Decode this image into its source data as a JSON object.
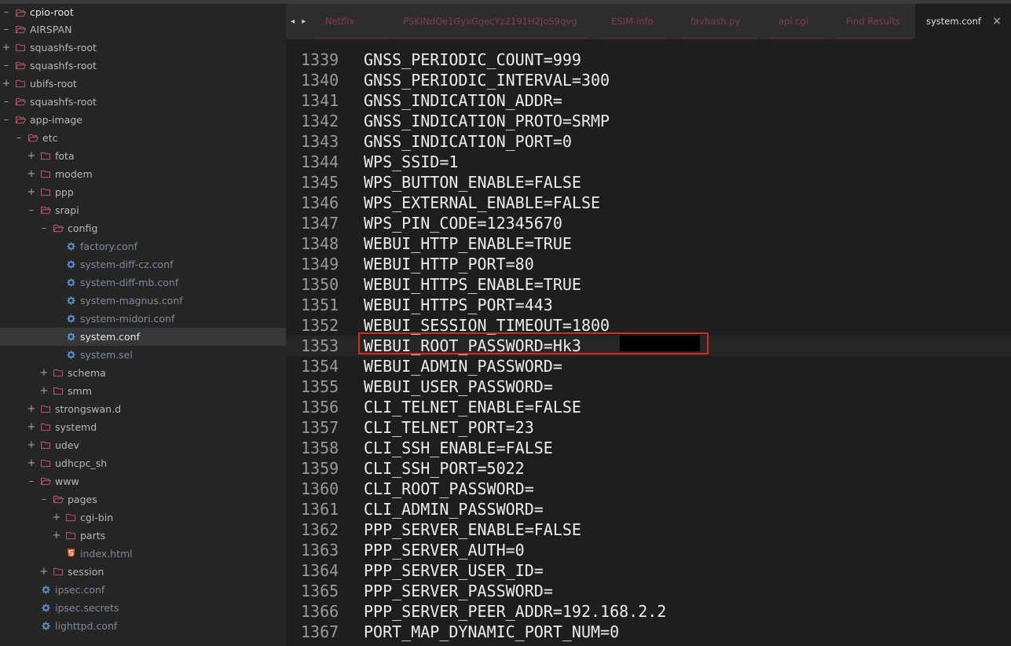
{
  "sidebar": {
    "tree": [
      {
        "label": "cpio-root",
        "depth": 0,
        "kind": "folder",
        "expanded": true
      },
      {
        "label": "AIRSPAN",
        "depth": 0,
        "kind": "folder",
        "expanded": true
      },
      {
        "label": "squashfs-root",
        "depth": 0,
        "kind": "folder",
        "expanded": false
      },
      {
        "label": "squashfs-root",
        "depth": 0,
        "kind": "folder",
        "expanded": true
      },
      {
        "label": "ubifs-root",
        "depth": 0,
        "kind": "folder",
        "expanded": false
      },
      {
        "label": "squashfs-root",
        "depth": 0,
        "kind": "folder",
        "expanded": true
      },
      {
        "label": "app-image",
        "depth": 0,
        "kind": "folder",
        "expanded": true
      },
      {
        "label": "etc",
        "depth": 1,
        "kind": "folder",
        "expanded": true
      },
      {
        "label": "fota",
        "depth": 2,
        "kind": "folder",
        "expanded": false
      },
      {
        "label": "modem",
        "depth": 2,
        "kind": "folder",
        "expanded": false
      },
      {
        "label": "ppp",
        "depth": 2,
        "kind": "folder",
        "expanded": false
      },
      {
        "label": "srapi",
        "depth": 2,
        "kind": "folder",
        "expanded": true
      },
      {
        "label": "config",
        "depth": 3,
        "kind": "folder",
        "expanded": true
      },
      {
        "label": "factory.conf",
        "depth": 4,
        "kind": "gear"
      },
      {
        "label": "system-diff-cz.conf",
        "depth": 4,
        "kind": "gear"
      },
      {
        "label": "system-diff-mb.conf",
        "depth": 4,
        "kind": "gear"
      },
      {
        "label": "system-magnus.conf",
        "depth": 4,
        "kind": "gear"
      },
      {
        "label": "system-midori.conf",
        "depth": 4,
        "kind": "gear"
      },
      {
        "label": "system.conf",
        "depth": 4,
        "kind": "gear",
        "selected": true
      },
      {
        "label": "system.sel",
        "depth": 4,
        "kind": "gear"
      },
      {
        "label": "schema",
        "depth": 3,
        "kind": "folder",
        "expanded": false
      },
      {
        "label": "smm",
        "depth": 3,
        "kind": "folder",
        "expanded": false
      },
      {
        "label": "strongswan.d",
        "depth": 2,
        "kind": "folder",
        "expanded": false
      },
      {
        "label": "systemd",
        "depth": 2,
        "kind": "folder",
        "expanded": false
      },
      {
        "label": "udev",
        "depth": 2,
        "kind": "folder",
        "expanded": false
      },
      {
        "label": "udhcpc_sh",
        "depth": 2,
        "kind": "folder",
        "expanded": false
      },
      {
        "label": "www",
        "depth": 2,
        "kind": "folder",
        "expanded": true
      },
      {
        "label": "pages",
        "depth": 3,
        "kind": "folder",
        "expanded": true
      },
      {
        "label": "cgi-bin",
        "depth": 4,
        "kind": "folder",
        "expanded": false
      },
      {
        "label": "parts",
        "depth": 4,
        "kind": "folder",
        "expanded": false
      },
      {
        "label": "index.html",
        "depth": 4,
        "kind": "html"
      },
      {
        "label": "session",
        "depth": 3,
        "kind": "folder",
        "expanded": false
      },
      {
        "label": "ipsec.conf",
        "depth": 2,
        "kind": "gear"
      },
      {
        "label": "ipsec.secrets",
        "depth": 2,
        "kind": "gear"
      },
      {
        "label": "lighttpd.conf",
        "depth": 2,
        "kind": "gear"
      }
    ]
  },
  "tabs": {
    "nav_arrows": "◂ ▸",
    "items": [
      {
        "label": "Netflix"
      },
      {
        "label": "PSKINdQe1GyxGgecYz2191H2JoS9qvg"
      },
      {
        "label": "ESIM-info"
      },
      {
        "label": "favhash.py"
      },
      {
        "label": "api.cgi"
      },
      {
        "label": "Find Results"
      },
      {
        "label": "system.conf",
        "active": true
      }
    ],
    "close_glyph": "×"
  },
  "editor": {
    "current_line": 1353,
    "lines": [
      {
        "n": "1339",
        "text": "GNSS_PERIODIC_COUNT=999"
      },
      {
        "n": "1340",
        "text": "GNSS_PERIODIC_INTERVAL=300"
      },
      {
        "n": "1341",
        "text": "GNSS_INDICATION_ADDR="
      },
      {
        "n": "1342",
        "text": "GNSS_INDICATION_PROTO=SRMP"
      },
      {
        "n": "1343",
        "text": "GNSS_INDICATION_PORT=0"
      },
      {
        "n": "1344",
        "text": "WPS_SSID=1"
      },
      {
        "n": "1345",
        "text": "WPS_BUTTON_ENABLE=FALSE"
      },
      {
        "n": "1346",
        "text": "WPS_EXTERNAL_ENABLE=FALSE"
      },
      {
        "n": "1347",
        "text": "WPS_PIN_CODE=12345670"
      },
      {
        "n": "1348",
        "text": "WEBUI_HTTP_ENABLE=TRUE"
      },
      {
        "n": "1349",
        "text": "WEBUI_HTTP_PORT=80"
      },
      {
        "n": "1350",
        "text": "WEBUI_HTTPS_ENABLE=TRUE"
      },
      {
        "n": "1351",
        "text": "WEBUI_HTTPS_PORT=443"
      },
      {
        "n": "1352",
        "text": "WEBUI_SESSION_TIMEOUT=1800"
      },
      {
        "n": "1353",
        "text": "WEBUI_ROOT_PASSWORD=Hk3"
      },
      {
        "n": "1354",
        "text": "WEBUI_ADMIN_PASSWORD="
      },
      {
        "n": "1355",
        "text": "WEBUI_USER_PASSWORD="
      },
      {
        "n": "1356",
        "text": "CLI_TELNET_ENABLE=FALSE"
      },
      {
        "n": "1357",
        "text": "CLI_TELNET_PORT=23"
      },
      {
        "n": "1358",
        "text": "CLI_SSH_ENABLE=FALSE"
      },
      {
        "n": "1359",
        "text": "CLI_SSH_PORT=5022"
      },
      {
        "n": "1360",
        "text": "CLI_ROOT_PASSWORD="
      },
      {
        "n": "1361",
        "text": "CLI_ADMIN_PASSWORD="
      },
      {
        "n": "1362",
        "text": "PPP_SERVER_ENABLE=FALSE"
      },
      {
        "n": "1363",
        "text": "PPP_SERVER_AUTH=0"
      },
      {
        "n": "1364",
        "text": "PPP_SERVER_USER_ID="
      },
      {
        "n": "1365",
        "text": "PPP_SERVER_PASSWORD="
      },
      {
        "n": "1366",
        "text": "PPP_SERVER_PEER_ADDR=192.168.2.2"
      },
      {
        "n": "1367",
        "text": "PORT_MAP_DYNAMIC_PORT_NUM=0"
      }
    ]
  },
  "colors": {
    "highlight_box": "#d42a2a",
    "folder_icon": "#c0566a",
    "gear_icon": "#5b8fc7",
    "html_icon": "#e5622f",
    "tab_inactive_text": "#8a3a4a"
  }
}
